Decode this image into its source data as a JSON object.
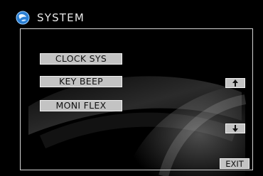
{
  "header": {
    "title": "SYSTEM",
    "icon": "system-globe-icon"
  },
  "menu": {
    "items": [
      {
        "label": "CLOCK SYS"
      },
      {
        "label": "KEY BEEP"
      },
      {
        "label": "MONI FLEX"
      }
    ]
  },
  "nav": {
    "up_icon": "arrow-up-icon",
    "down_icon": "arrow-down-icon",
    "exit_label": "EXIT"
  },
  "colors": {
    "background": "#000000",
    "frame": "#d4d4d4",
    "button_fill": "#c3c3c3",
    "button_border": "#f2f2f2",
    "icon_blue": "#2a7fd4",
    "text": "#e8e8e8"
  }
}
